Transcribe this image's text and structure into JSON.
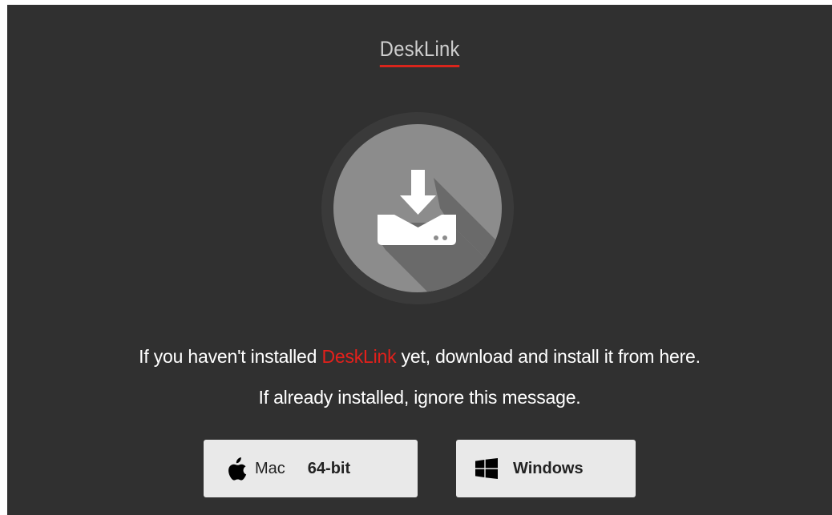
{
  "app": {
    "title": "DeskLink"
  },
  "colors": {
    "panel_bg": "#303030",
    "accent": "#e3201b",
    "button_bg": "#e9e9e9"
  },
  "icon": {
    "name": "download-to-drive-icon"
  },
  "message": {
    "line1_before": "If you haven't installed ",
    "line1_brand": "DeskLink",
    "line1_after": " yet, download and install it from here.",
    "line2": "If already installed, ignore this message."
  },
  "buttons": {
    "mac": {
      "icon": "apple-icon",
      "label": "Mac",
      "bits": "64-bit"
    },
    "windows": {
      "icon": "windows-icon",
      "label": "Windows"
    }
  }
}
